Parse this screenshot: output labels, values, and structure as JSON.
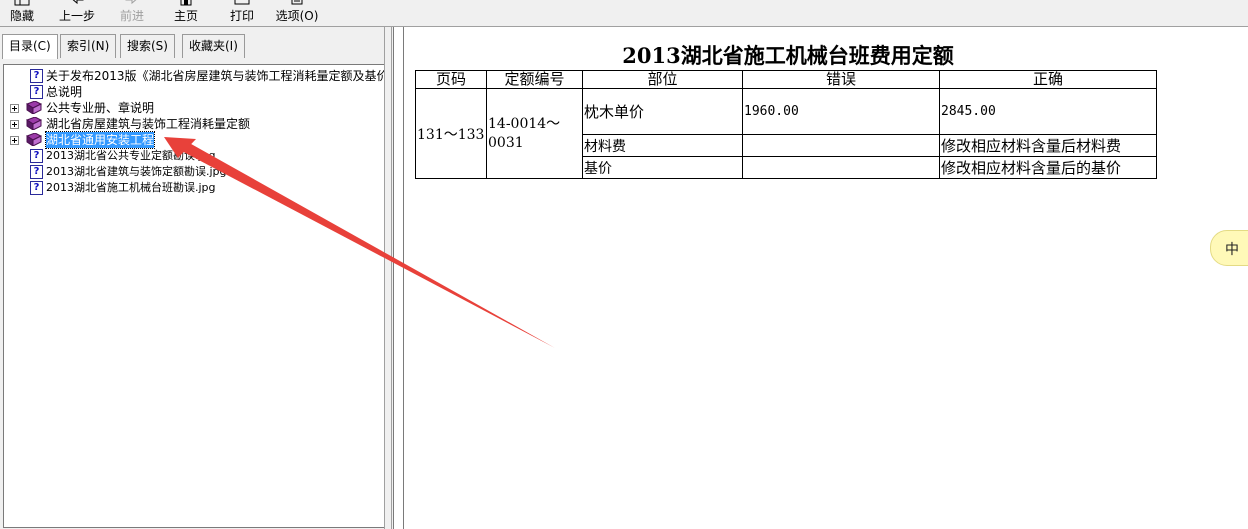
{
  "toolbar": {
    "hide": "隐藏",
    "back": "上一步",
    "forward": "前进",
    "home": "主页",
    "print": "打印",
    "options": "选项(O)"
  },
  "tabs": [
    "目录(C)",
    "索引(N)",
    "搜索(S)",
    "收藏夹(I)"
  ],
  "tree": {
    "items": [
      {
        "label": "关于发布2013版《湖北省房屋建筑与装饰工程消耗量定额及基价",
        "icon": "help-page-icon"
      },
      {
        "label": "总说明",
        "icon": "help-page-icon"
      },
      {
        "label": "公共专业册、章说明",
        "icon": "book-icon"
      },
      {
        "label": "湖北省房屋建筑与装饰工程消耗量定额",
        "icon": "book-icon"
      },
      {
        "label": "湖北省通用安装工程",
        "icon": "book-icon",
        "selected": true
      },
      {
        "label": "2013湖北省公共专业定额勘误.jpg",
        "icon": "help-page-icon"
      },
      {
        "label": "2013湖北省建筑与装饰定额勘误.jpg",
        "icon": "help-page-icon"
      },
      {
        "label": "2013湖北省施工机械台班勘误.jpg",
        "icon": "help-page-icon"
      }
    ]
  },
  "document": {
    "title": "2013湖北省施工机械台班费用定额",
    "headers": [
      "页码",
      "定额编号",
      "部位",
      "错误",
      "正确"
    ],
    "page_range": "131～133",
    "quota_no_1": "14-0014～",
    "quota_no_2": "0031",
    "rows": [
      {
        "part": "枕木单价",
        "wrong": "1960.00",
        "right": "2845.00"
      },
      {
        "part": "材料费",
        "wrong": "",
        "right": "修改相应材料含量后材料费"
      },
      {
        "part": "基价",
        "wrong": "",
        "right": "修改相应材料含量后的基价"
      }
    ]
  },
  "ime": {
    "text": "中"
  },
  "colors": {
    "selection": "#3399ff",
    "arrow": "#e8413a",
    "book": "#7a2a8a"
  }
}
